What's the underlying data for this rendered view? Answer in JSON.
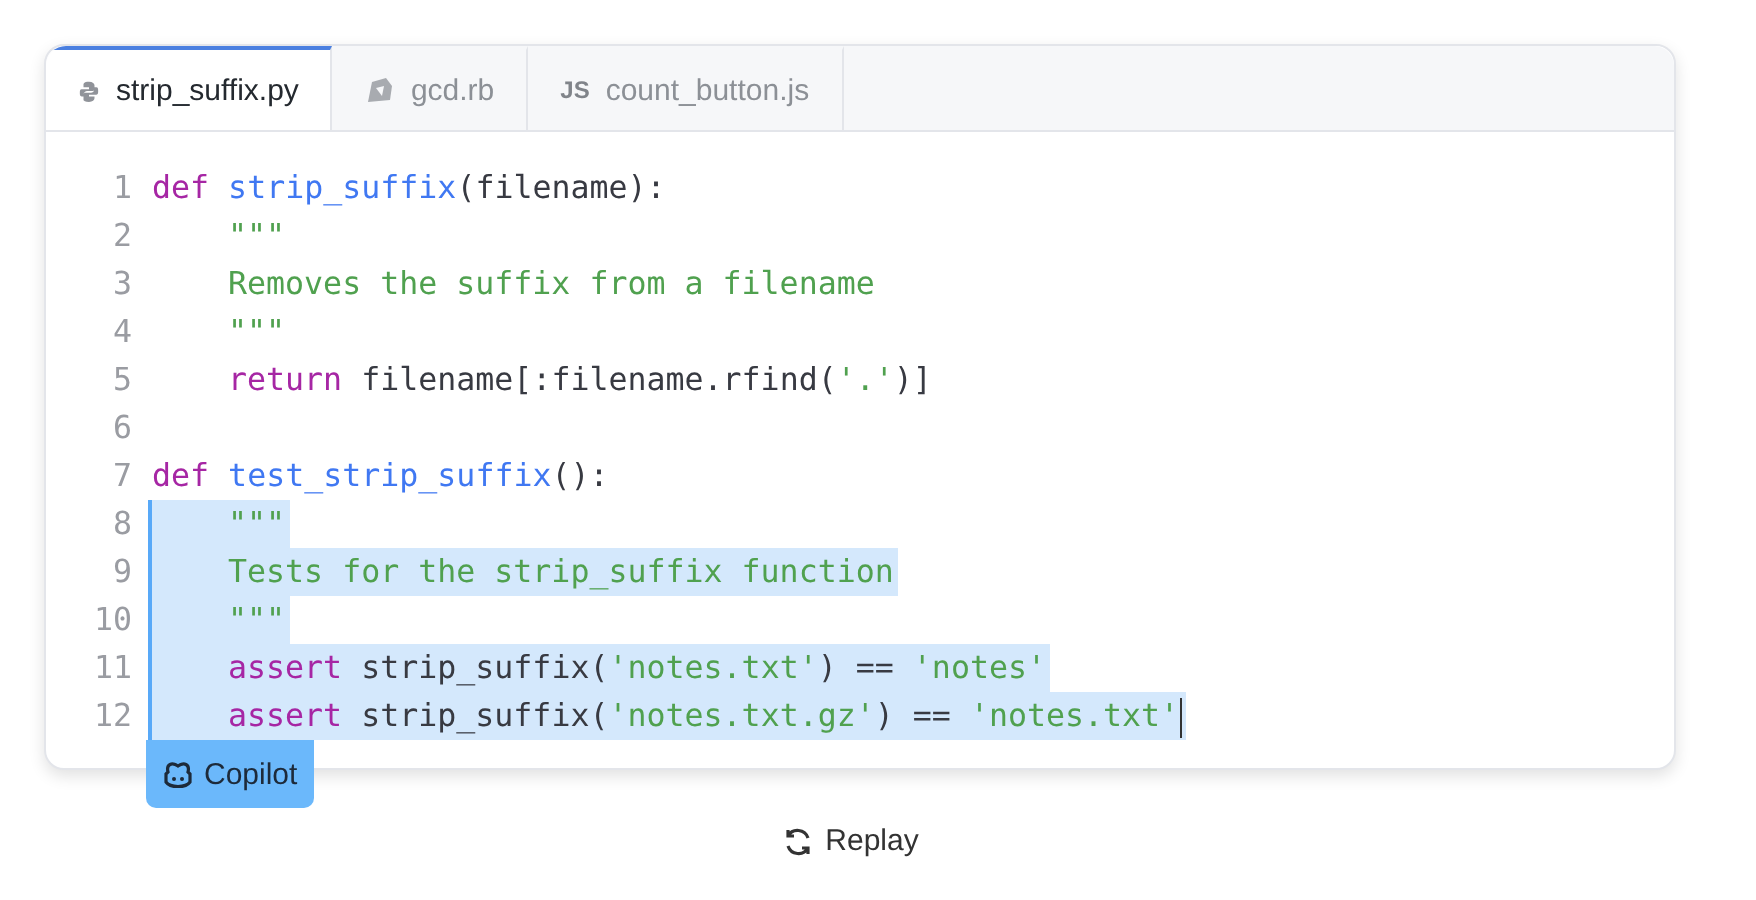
{
  "tabs": [
    {
      "label": "strip_suffix.py",
      "kind": "python",
      "selected": true
    },
    {
      "label": "gcd.rb",
      "kind": "ruby",
      "selected": false
    },
    {
      "label": "count_button.js",
      "kind": "js",
      "selected": false
    }
  ],
  "icon_text": "JS",
  "lines": [
    {
      "number": "1",
      "highlighted": false,
      "tokens": [
        {
          "kind": "keyword",
          "text": "def"
        },
        {
          "kind": "function",
          "text": " strip_suffix"
        },
        {
          "kind": "plain",
          "text": "(filename):"
        }
      ]
    },
    {
      "number": "2",
      "highlighted": false,
      "indented": true,
      "tokens": [
        {
          "kind": "string",
          "text": "\"\"\""
        }
      ]
    },
    {
      "number": "3",
      "highlighted": false,
      "indented": true,
      "tokens": [
        {
          "kind": "string",
          "text": "Removes the suffix from a filename"
        }
      ]
    },
    {
      "number": "4",
      "highlighted": false,
      "indented": true,
      "tokens": [
        {
          "kind": "string",
          "text": "\"\"\""
        }
      ]
    },
    {
      "number": "5",
      "highlighted": false,
      "indented": true,
      "tokens": [
        {
          "kind": "keyword",
          "text": "return"
        },
        {
          "kind": "plain",
          "text": " filename[:filename.rfind("
        },
        {
          "kind": "string",
          "text": "'.'"
        },
        {
          "kind": "plain",
          "text": ")]"
        }
      ]
    },
    {
      "number": "6",
      "highlighted": false
    },
    {
      "number": "7",
      "highlighted": false,
      "tokens": [
        {
          "kind": "keyword",
          "text": "def"
        },
        {
          "kind": "function",
          "text": " test_strip_suffix"
        },
        {
          "kind": "plain",
          "text": "():"
        }
      ]
    },
    {
      "number": "8",
      "highlighted": true,
      "indented": true,
      "tokens": [
        {
          "kind": "string",
          "text": "\"\"\""
        }
      ]
    },
    {
      "number": "9",
      "highlighted": true,
      "indented": true,
      "tokens": [
        {
          "kind": "string",
          "text": "Tests for the strip_suffix function"
        }
      ]
    },
    {
      "number": "10",
      "highlighted": true,
      "indented": true,
      "tokens": [
        {
          "kind": "string",
          "text": "\"\"\""
        }
      ]
    },
    {
      "number": "11",
      "highlighted": true,
      "indented": true,
      "tokens": [
        {
          "kind": "keyword",
          "text": "assert"
        },
        {
          "kind": "plain",
          "text": " strip_suffix("
        },
        {
          "kind": "string",
          "text": "'notes.txt'"
        },
        {
          "kind": "plain",
          "text": ") == "
        },
        {
          "kind": "string",
          "text": "'notes'"
        }
      ]
    },
    {
      "number": "12",
      "highlighted": true,
      "indented": true,
      "cursor": true,
      "tokens": [
        {
          "kind": "keyword",
          "text": "assert"
        },
        {
          "kind": "plain",
          "text": " strip_suffix("
        },
        {
          "kind": "string",
          "text": "'notes.txt.gz'"
        },
        {
          "kind": "plain",
          "text": ") == "
        },
        {
          "kind": "string",
          "text": "'notes.txt'"
        }
      ]
    }
  ],
  "badge": {
    "label": "Copilot"
  },
  "replay": {
    "label": "Replay"
  }
}
